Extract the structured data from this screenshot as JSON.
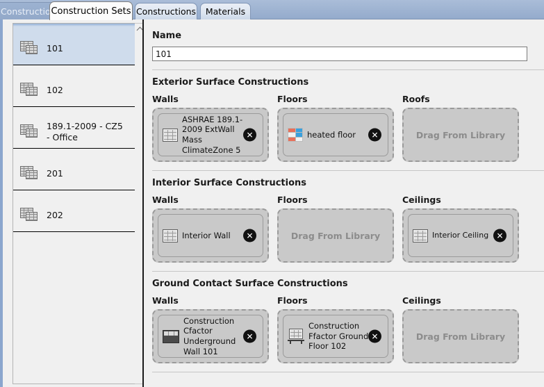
{
  "tabs": [
    {
      "label": "Constructions",
      "state": "cut"
    },
    {
      "label": "Construction Sets",
      "state": "active"
    },
    {
      "label": "Constructions",
      "state": "normal"
    },
    {
      "label": "Materials",
      "state": "normal"
    }
  ],
  "sidebar": {
    "items": [
      {
        "label": "101",
        "icon": "brick-stack-icon",
        "selected": true
      },
      {
        "label": "102",
        "icon": "brick-stack-icon",
        "selected": false
      },
      {
        "label": "189.1-2009 - CZ5 - Office",
        "icon": "brick-stack-icon",
        "selected": false
      },
      {
        "label": "201",
        "icon": "brick-stack-icon",
        "selected": false
      },
      {
        "label": "202",
        "icon": "brick-stack-icon",
        "selected": false
      }
    ],
    "scroll_up_icon": "chevron-up-icon"
  },
  "editor": {
    "name_label": "Name",
    "name_value": "101",
    "empty_text": "Drag From Library",
    "remove_glyph": "✕",
    "sections": [
      {
        "title": "Exterior Surface Constructions",
        "columns": [
          {
            "header": "Walls",
            "filled": true,
            "text": "ASHRAE 189.1-2009 ExtWall Mass ClimateZone 5",
            "icon": "brick-wall-icon",
            "clipped": true
          },
          {
            "header": "Floors",
            "filled": true,
            "text": "heated floor",
            "icon": "heated-floor-icon",
            "clipped": false
          },
          {
            "header": "Roofs",
            "filled": false,
            "text": "",
            "icon": "",
            "clipped": false
          }
        ]
      },
      {
        "title": "Interior Surface Constructions",
        "columns": [
          {
            "header": "Walls",
            "filled": true,
            "text": "Interior Wall",
            "icon": "brick-wall-icon",
            "clipped": false
          },
          {
            "header": "Floors",
            "filled": false,
            "text": "",
            "icon": "",
            "clipped": false
          },
          {
            "header": "Ceilings",
            "filled": true,
            "text": "Interior Ceiling",
            "icon": "brick-wall-icon",
            "clipped": false
          }
        ]
      },
      {
        "title": "Ground Contact Surface Constructions",
        "columns": [
          {
            "header": "Walls",
            "filled": true,
            "text": "Construction Cfactor Underground Wall 101",
            "icon": "underground-wall-icon",
            "clipped": true
          },
          {
            "header": "Floors",
            "filled": true,
            "text": "Construction Ffactor Ground Floor 102",
            "icon": "ffactor-floor-icon",
            "clipped": false
          },
          {
            "header": "Ceilings",
            "filled": false,
            "text": "",
            "icon": "",
            "clipped": false
          }
        ]
      }
    ]
  },
  "colors": {
    "tabbar": "#9fb4d2",
    "selection": "#cfdcec",
    "dropzone_bg": "#c9c9c9",
    "dropzone_border": "#9a9a9a",
    "empty_text": "#8c8c8c",
    "heated_floor_red": "#e8705a",
    "heated_floor_blue": "#3aa0dd"
  }
}
